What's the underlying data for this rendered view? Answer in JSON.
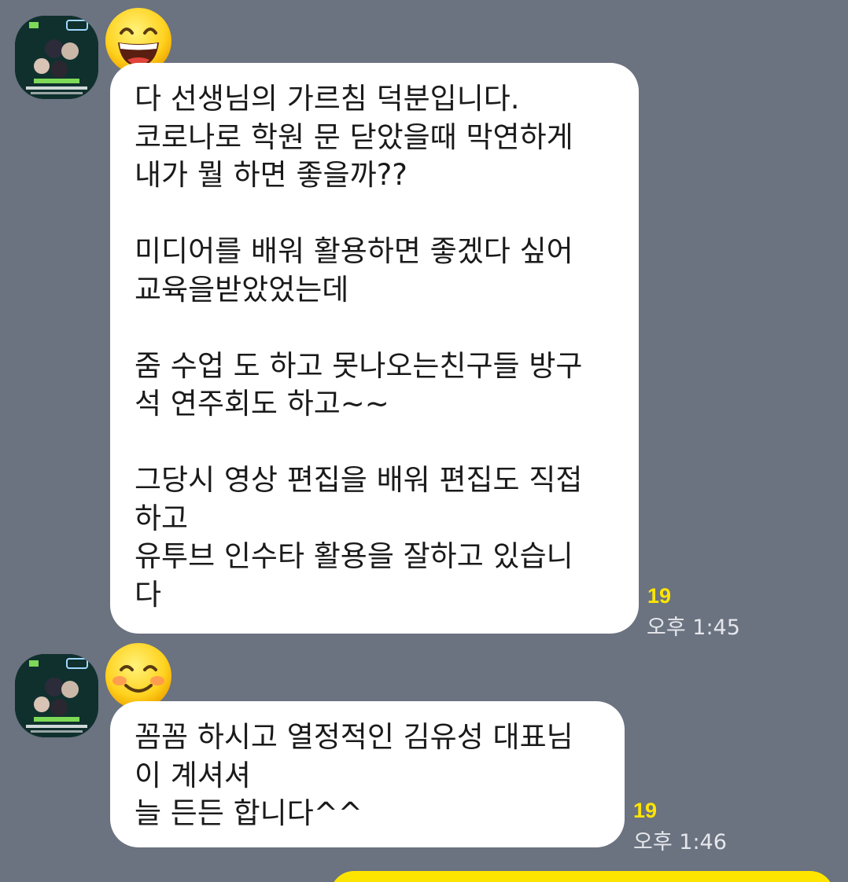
{
  "theme": {
    "background": "#6b7280",
    "bubble_in": "#ffffff",
    "bubble_out": "#fee500",
    "unread_color": "#fee500",
    "meta_color": "#e5e7eb"
  },
  "messages": [
    {
      "sender_name": "",
      "avatar_icon": "concert-poster-avatar",
      "emoji_icon": "grinning-face-emoji",
      "lines": [
        "다 선생님의 가르침 덕분입니다.",
        "코로나로 학원 문 닫았을때 막연하게",
        "내가 뭘 하면 좋을까??",
        "",
        "미디어를 배워 활용하면 좋겠다 싶어",
        "교육을받았었는데",
        "",
        "줌 수업 도 하고 못나오는친구들 방구",
        "석 연주회도 하고~~",
        "",
        "그당시 영상 편집을 배워 편집도 직접",
        "하고",
        "유투브 인수타 활용을 잘하고 있습니",
        "다"
      ],
      "unread_count": "19",
      "time": "오후 1:45"
    },
    {
      "sender_name": "",
      "avatar_icon": "concert-poster-avatar",
      "emoji_icon": "smiling-blush-face-emoji",
      "lines": [
        "꼼꼼 하시고 열정적인 김유성 대표님",
        "이 계셔셔",
        "늘 든든 합니다^^"
      ],
      "unread_count": "19",
      "time": "오후 1:46"
    }
  ],
  "poster": {
    "title_ko": "강화도우리마을",
    "subtitle": "Small Outreach Concert 2023",
    "brand": "Enno"
  }
}
